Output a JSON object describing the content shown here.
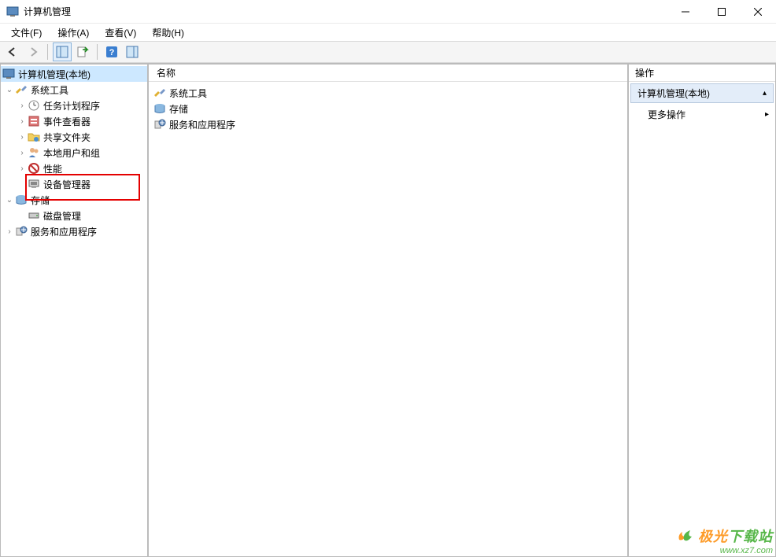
{
  "window": {
    "title": "计算机管理"
  },
  "menus": {
    "file": "文件(F)",
    "action": "操作(A)",
    "view": "查看(V)",
    "help": "帮助(H)"
  },
  "tree": {
    "root": "计算机管理(本地)",
    "system_tools": "系统工具",
    "task_scheduler": "任务计划程序",
    "event_viewer": "事件查看器",
    "shared_folders": "共享文件夹",
    "local_users": "本地用户和组",
    "performance": "性能",
    "device_manager": "设备管理器",
    "storage": "存储",
    "disk_mgmt": "磁盘管理",
    "services_apps": "服务和应用程序"
  },
  "list": {
    "header_name": "名称",
    "items": {
      "system_tools": "系统工具",
      "storage": "存储",
      "services_apps": "服务和应用程序"
    }
  },
  "actions": {
    "header": "操作",
    "title": "计算机管理(本地)",
    "more": "更多操作"
  },
  "watermark": {
    "line1a": "极光",
    "line1b": "下载站",
    "line2": "www.xz7.com"
  }
}
